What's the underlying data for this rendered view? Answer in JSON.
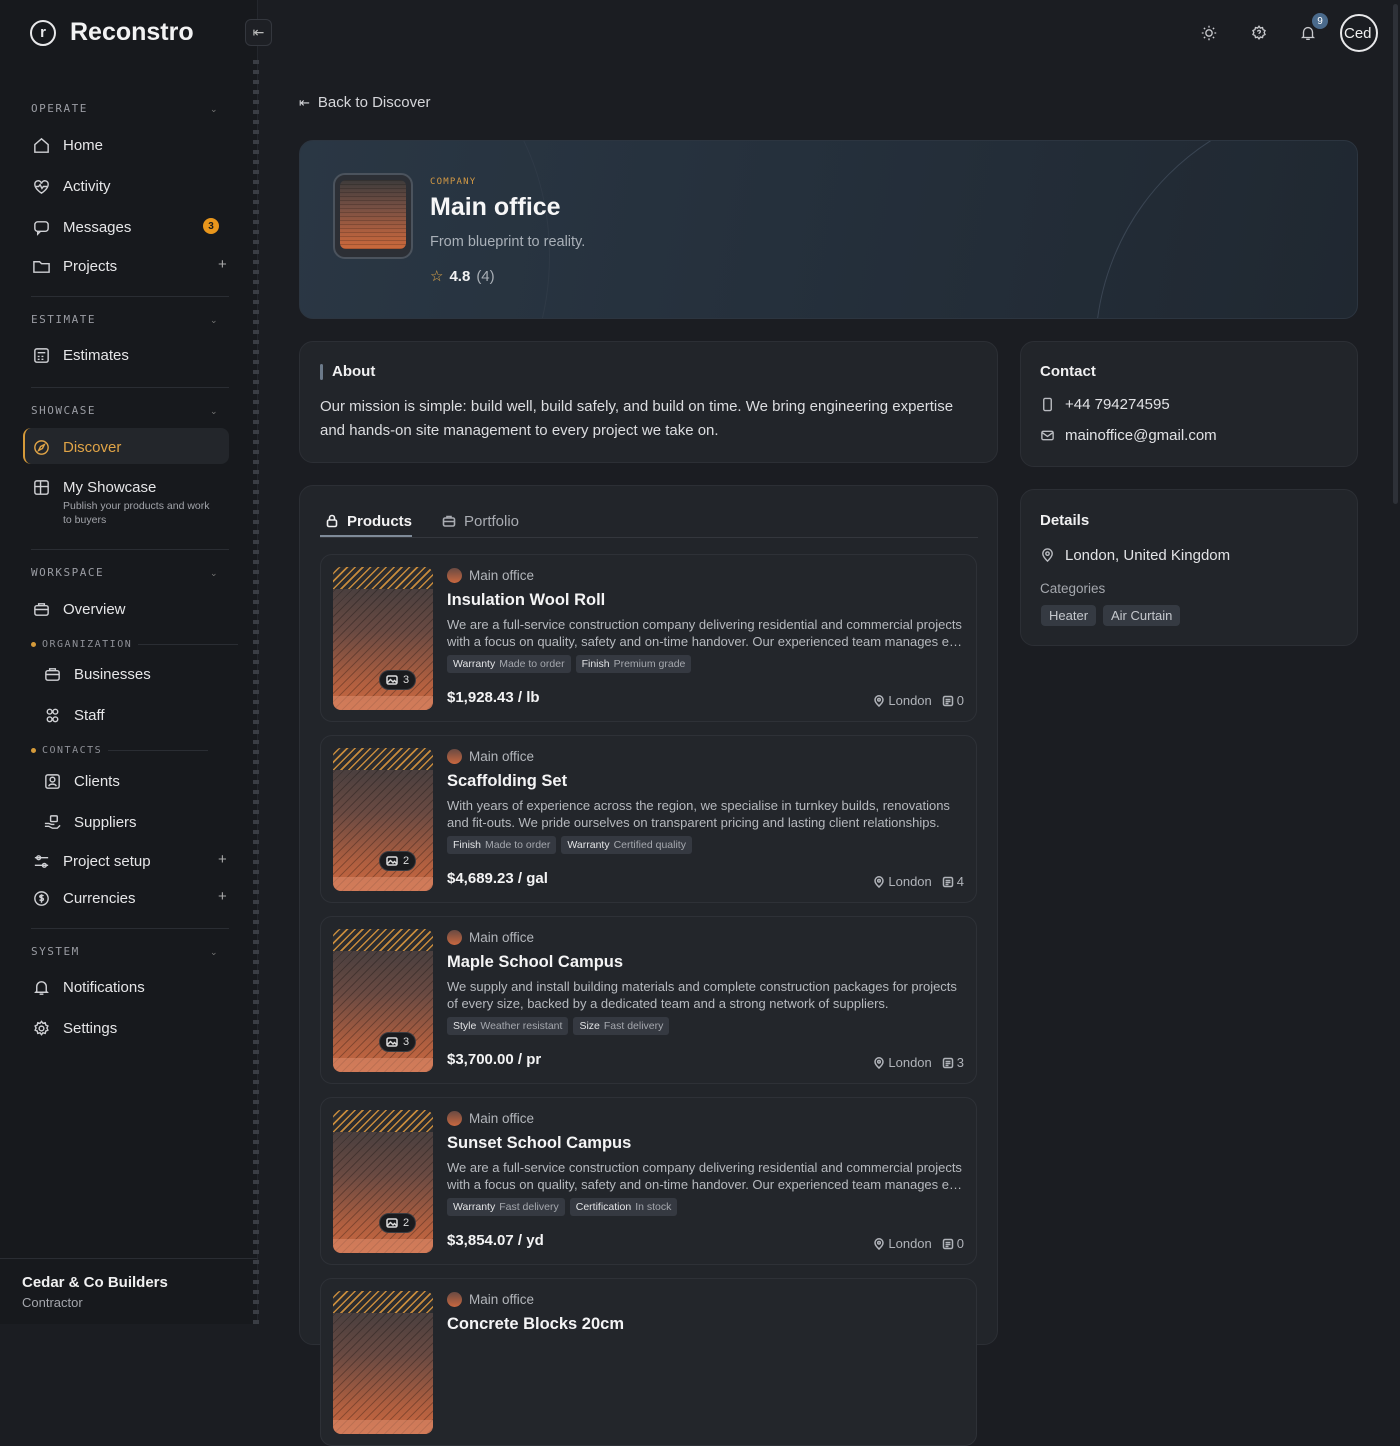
{
  "app": {
    "name": "Reconstro"
  },
  "sidebar": {
    "sections": {
      "operate": "OPERATE",
      "estimate": "ESTIMATE",
      "showcase": "SHOWCASE",
      "workspace": "WORKSPACE",
      "system": "SYSTEM"
    },
    "subsections": {
      "organization": "ORGANIZATION",
      "contacts": "CONTACTS"
    },
    "items": {
      "home": "Home",
      "activity": "Activity",
      "messages": "Messages",
      "messages_badge": "3",
      "projects": "Projects",
      "estimates": "Estimates",
      "discover": "Discover",
      "my_showcase": "My Showcase",
      "my_showcase_hint": "Publish your products and work to buyers",
      "overview": "Overview",
      "businesses": "Businesses",
      "staff": "Staff",
      "clients": "Clients",
      "suppliers": "Suppliers",
      "project_setup": "Project setup",
      "currencies": "Currencies",
      "notifications": "Notifications",
      "settings": "Settings"
    },
    "plus": "+",
    "footer": {
      "org": "Cedar & Co Builders",
      "role": "Contractor"
    }
  },
  "topbar": {
    "notif_count": "9",
    "avatar_text": "Ced"
  },
  "back_link": "Back to Discover",
  "company": {
    "eyebrow": "COMPANY",
    "name": "Main office",
    "tagline": "From blueprint to reality.",
    "rating": "4.8",
    "rating_count": "(4)"
  },
  "about": {
    "title": "About",
    "text": "Our mission is simple: build well, build safely, and build on time. We bring engineering expertise and hands-on site management to every project we take on."
  },
  "contact": {
    "title": "Contact",
    "phone": "+44 794274595",
    "email": "mainoffice@gmail.com"
  },
  "details": {
    "title": "Details",
    "location": "London, United Kingdom",
    "categories_label": "Categories",
    "categories": [
      "Heater",
      "Air Curtain"
    ]
  },
  "tabs": [
    {
      "label": "Products",
      "active": true
    },
    {
      "label": "Portfolio",
      "active": false
    }
  ],
  "products": [
    {
      "seller": "Main office",
      "title": "Insulation Wool Roll",
      "desc1": "We are a full-service construction company delivering residential and commercial projects",
      "desc2": "with a focus on quality, safety and on-time handover. Our experienced team manages eve...",
      "tags": [
        {
          "k": "Warranty",
          "v": "Made to order"
        },
        {
          "k": "Finish",
          "v": "Premium grade"
        }
      ],
      "price": "$1,928.43 / lb",
      "location": "London",
      "quotes": "0",
      "images": "3"
    },
    {
      "seller": "Main office",
      "title": "Scaffolding Set",
      "desc1": "With years of experience across the region, we specialise in turnkey builds, renovations",
      "desc2": "and fit-outs. We pride ourselves on transparent pricing and lasting client relationships.",
      "tags": [
        {
          "k": "Finish",
          "v": "Made to order"
        },
        {
          "k": "Warranty",
          "v": "Certified quality"
        }
      ],
      "price": "$4,689.23 / gal",
      "location": "London",
      "quotes": "4",
      "images": "2"
    },
    {
      "seller": "Main office",
      "title": "Maple School Campus",
      "desc1": "We supply and install building materials and complete construction packages for projects",
      "desc2": "of every size, backed by a dedicated team and a strong network of suppliers.",
      "tags": [
        {
          "k": "Style",
          "v": "Weather resistant"
        },
        {
          "k": "Size",
          "v": "Fast delivery"
        }
      ],
      "price": "$3,700.00 / pr",
      "location": "London",
      "quotes": "3",
      "images": "3"
    },
    {
      "seller": "Main office",
      "title": "Sunset School Campus",
      "desc1": "We are a full-service construction company delivering residential and commercial projects",
      "desc2": "with a focus on quality, safety and on-time handover. Our experienced team manages eve...",
      "tags": [
        {
          "k": "Warranty",
          "v": "Fast delivery"
        },
        {
          "k": "Certification",
          "v": "In stock"
        }
      ],
      "price": "$3,854.07 / yd",
      "location": "London",
      "quotes": "0",
      "images": "2"
    },
    {
      "seller": "Main office",
      "title": "Concrete Blocks 20cm",
      "desc1": "",
      "desc2": "",
      "tags": [],
      "price": "",
      "location": "",
      "quotes": "",
      "images": ""
    }
  ]
}
